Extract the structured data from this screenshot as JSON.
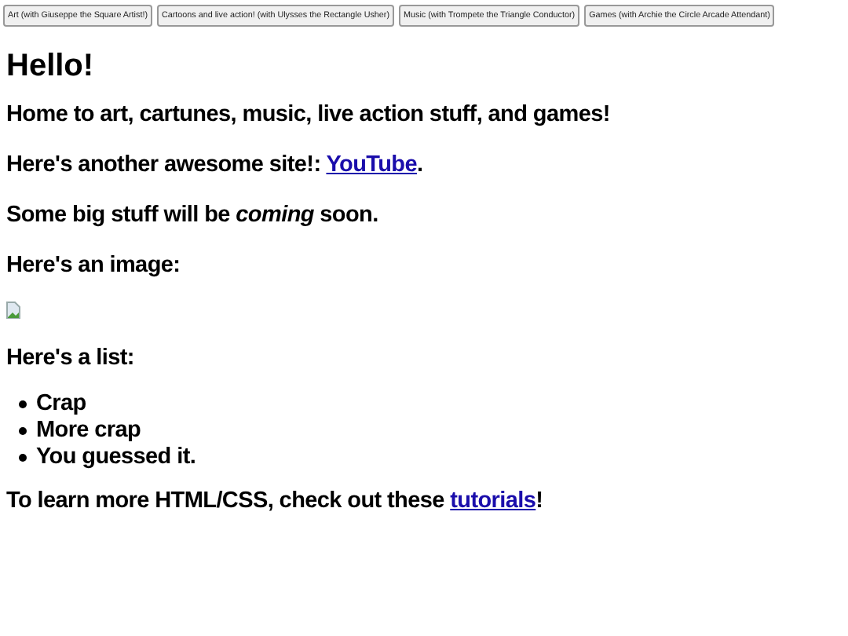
{
  "nav_buttons": [
    "Art (with Giuseppe the Square Artist!)",
    "Cartoons and live action! (with Ulysses the Rectangle Usher)",
    "Music (with Trompete the Triangle Conductor)",
    "Games (with Archie the Circle Arcade Attendant)"
  ],
  "title": "Hello!",
  "blocks": [
    {
      "kind": "text",
      "parts": [
        {
          "text": "Home to art, cartunes, music, live action stuff, and games!"
        }
      ]
    },
    {
      "kind": "text",
      "parts": [
        {
          "text": "Here's another awesome site!: "
        },
        {
          "link": "YouTube"
        },
        {
          "text": "."
        }
      ]
    },
    {
      "kind": "text",
      "parts": [
        {
          "text": "Some big stuff will be *coming* soon."
        }
      ]
    },
    {
      "kind": "text",
      "parts": [
        {
          "text": "Here's an image:"
        }
      ]
    },
    {
      "kind": "image"
    },
    {
      "kind": "text",
      "parts": [
        {
          "text": "Here's a list:"
        }
      ]
    },
    {
      "kind": "list",
      "items": [
        "Crap",
        "More crap",
        "You guessed it."
      ]
    },
    {
      "kind": "text",
      "parts": [
        {
          "text": "To learn more HTML/CSS, check out these "
        },
        {
          "link": "tutorials"
        },
        {
          "text": "!"
        }
      ]
    }
  ]
}
